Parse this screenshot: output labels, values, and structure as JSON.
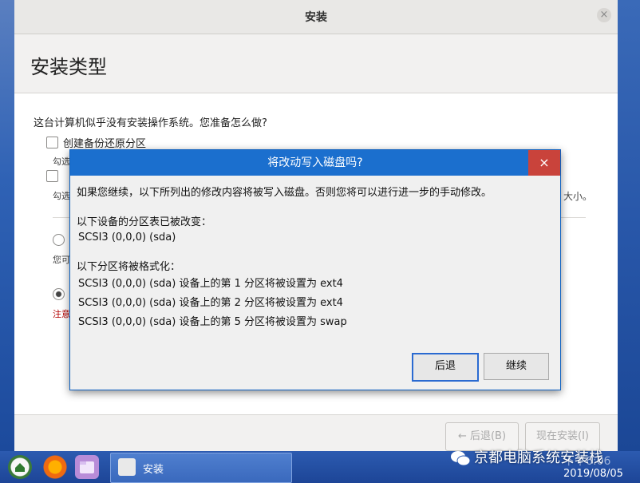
{
  "window": {
    "title": "安装",
    "close_glyph": "×"
  },
  "page": {
    "heading": "安装类型",
    "question": "这台计算机似乎没有安装操作系统。您准备怎么做?",
    "option_backup": "创建备份还原分区",
    "sub_1": "勾选",
    "sub_2": "勾选",
    "right_overflow": "大小。",
    "radio_sub": "您可",
    "warn": "注意"
  },
  "buttons": {
    "back": "← 后退(B)",
    "install": "现在安装(I)"
  },
  "dialog": {
    "title": "将改动写入磁盘吗?",
    "close_glyph": "×",
    "intro": "如果您继续，以下所列出的修改内容将被写入磁盘。否则您将可以进行进一步的手动修改。",
    "table_header": "以下设备的分区表已被改变：",
    "table_device": "SCSI3 (0,0,0) (sda)",
    "format_header": "以下分区将被格式化：",
    "format_lines": [
      "SCSI3 (0,0,0) (sda) 设备上的第 1 分区将被设置为 ext4",
      "SCSI3 (0,0,0) (sda) 设备上的第 2 分区将被设置为 ext4",
      "SCSI3 (0,0,0) (sda) 设备上的第 5 分区将被设置为 swap"
    ],
    "back_label": "后退",
    "continue_label": "继续"
  },
  "taskbar": {
    "task_label": "安装",
    "watermark": "京都电脑系统安装栈",
    "clock_time": "下午6:06",
    "date": "2019/08/05",
    "icons": [
      "home-icon",
      "firefox-icon",
      "files-icon",
      "installer-icon",
      "wechat-icon"
    ]
  }
}
